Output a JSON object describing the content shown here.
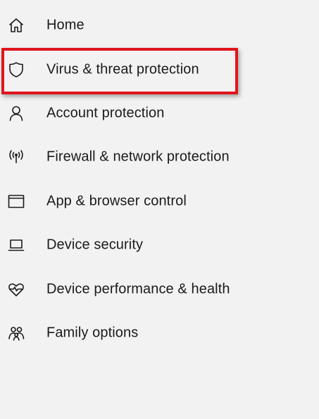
{
  "sidebar": {
    "items": [
      {
        "label": "Home",
        "icon": "home-icon"
      },
      {
        "label": "Virus & threat protection",
        "icon": "shield-icon"
      },
      {
        "label": "Account protection",
        "icon": "person-icon"
      },
      {
        "label": "Firewall & network protection",
        "icon": "wireless-antenna-icon"
      },
      {
        "label": "App & browser control",
        "icon": "app-window-icon"
      },
      {
        "label": "Device security",
        "icon": "laptop-icon"
      },
      {
        "label": "Device performance & health",
        "icon": "heart-pulse-icon"
      },
      {
        "label": "Family options",
        "icon": "family-icon"
      }
    ]
  },
  "annotation": {
    "highlight_color": "#e0151c",
    "highlighted_item": "Virus & threat protection"
  }
}
